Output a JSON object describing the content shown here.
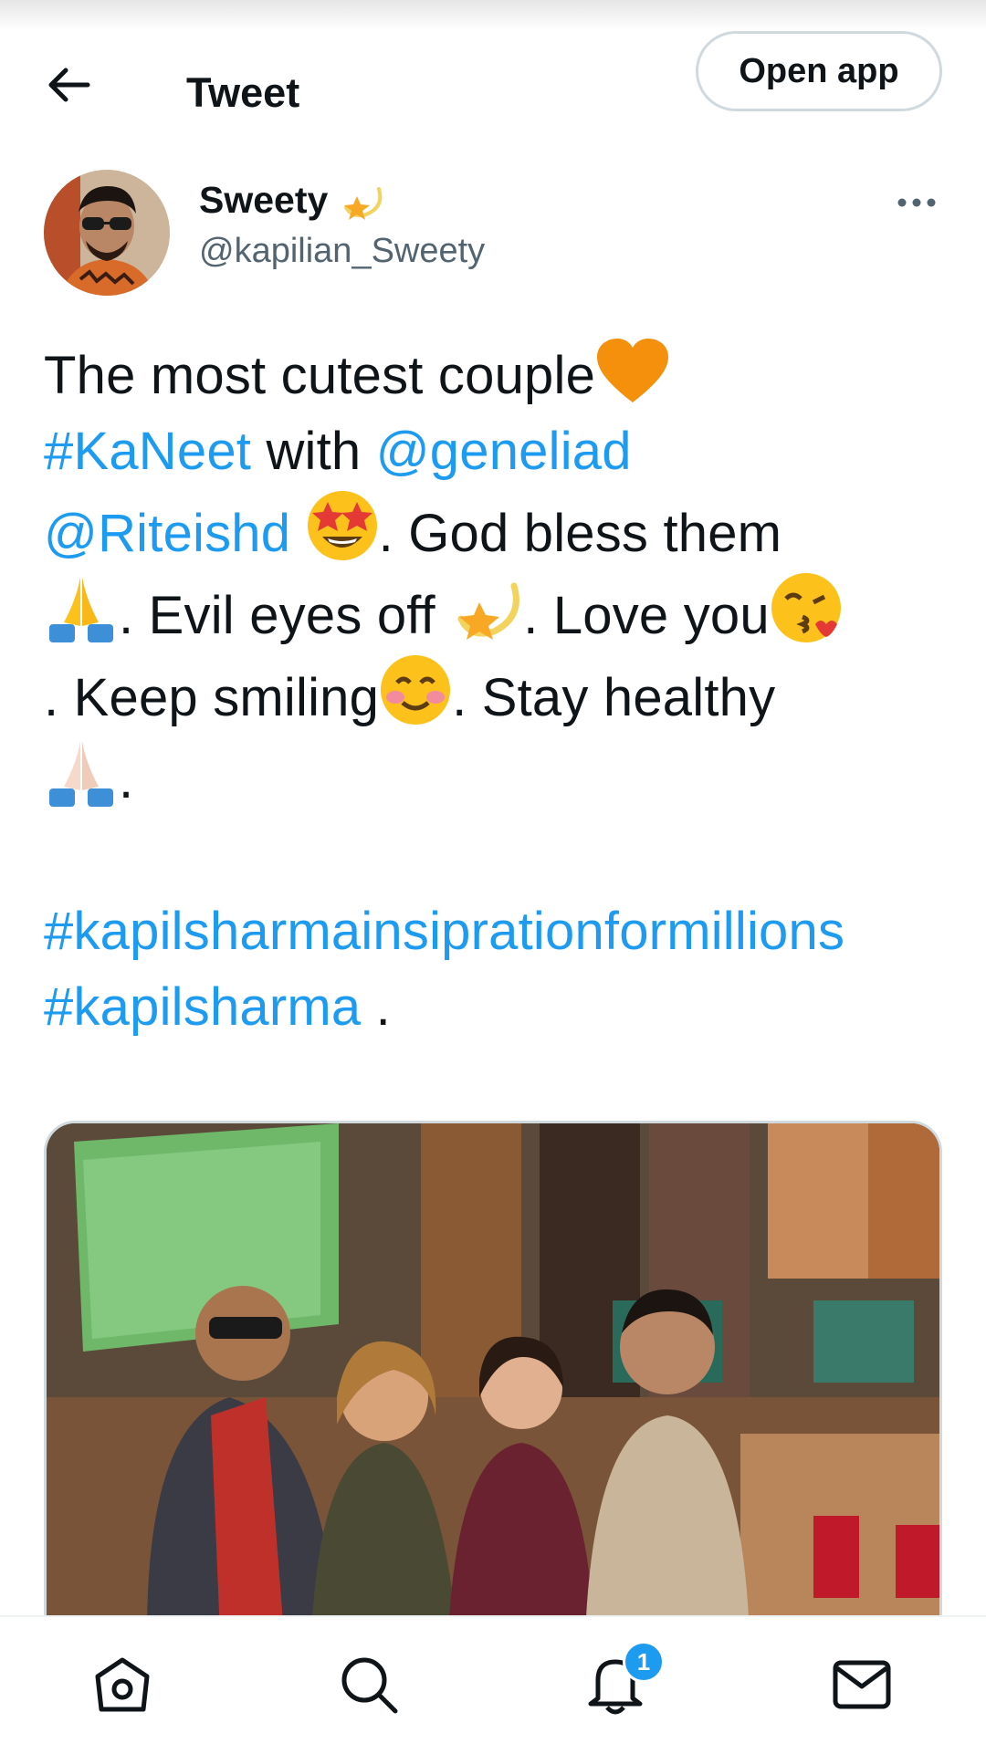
{
  "header": {
    "title": "Tweet",
    "open_app_label": "Open app"
  },
  "author": {
    "display_name": "Sweety",
    "handle": "@kapilian_Sweety"
  },
  "tweet": {
    "t1": "The most cutest couple",
    "hashtag1": "#KaNeet",
    "t2": " with ",
    "mention1": "@geneliad",
    "mention2": "@Riteishd",
    "t3": ". God bless them ",
    "t4": ". Evil eyes off ",
    "t5": ". Love you",
    "t6": ". Keep smiling",
    "t7": ". Stay healthy ",
    "t8": ".",
    "hashtag2": "#kapilsharmainsiprationformillions",
    "hashtag3": "#kapilsharma",
    "t9": " ."
  },
  "nav": {
    "notification_count": "1"
  },
  "colors": {
    "link": "#1d9bf0",
    "text": "#0f1419",
    "secondary": "#536471",
    "border": "#cfd9de"
  },
  "icons": [
    "back-arrow-icon",
    "dizzy-emoji-icon",
    "more-icon",
    "orange-heart-emoji-icon",
    "star-struck-emoji-icon",
    "folded-hands-emoji-icon",
    "kiss-emoji-icon",
    "smiling-blush-emoji-icon",
    "home-icon",
    "search-icon",
    "notifications-icon",
    "messages-icon"
  ]
}
